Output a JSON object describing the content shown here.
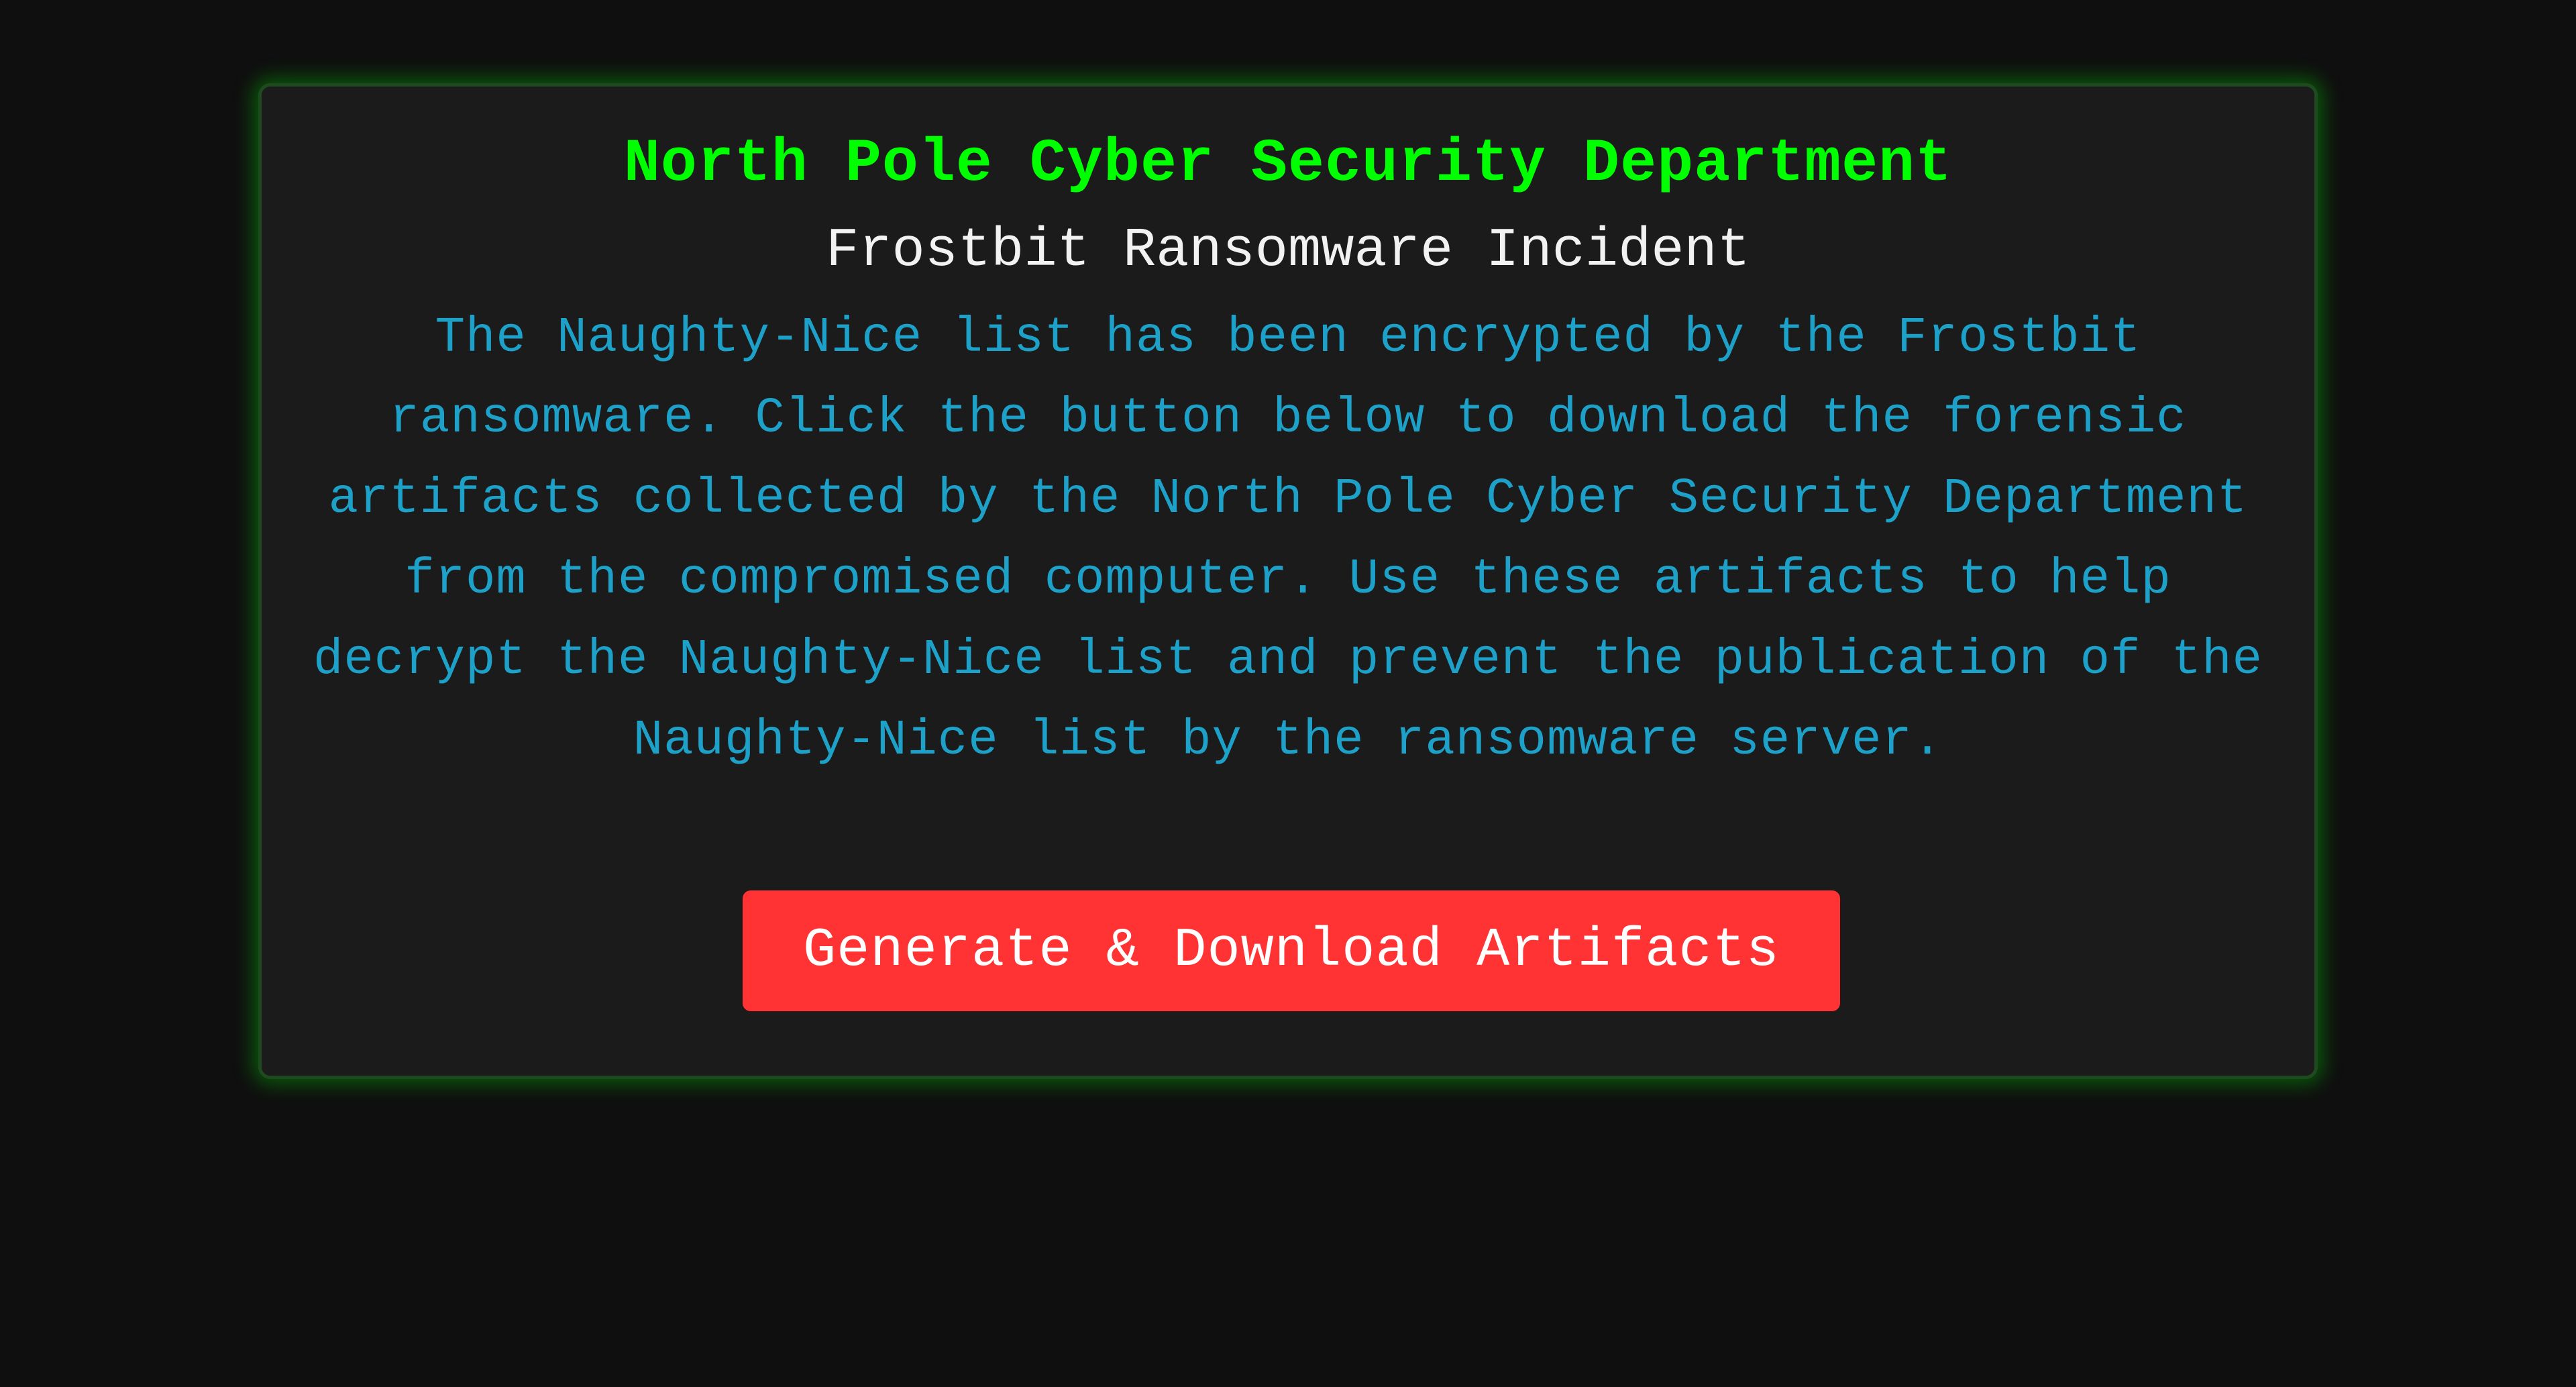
{
  "page": {
    "background_color": "#0f0f0f"
  },
  "card": {
    "title": "North Pole Cyber Security Department",
    "subtitle": "Frostbit Ransomware Incident",
    "description": "The Naughty-Nice list has been encrypted by the Frostbit ransomware. Click the button below to download the forensic artifacts collected by the North Pole Cyber Security Department from the compromised computer. Use these artifacts to help decrypt the Naughty-Nice list and prevent the publication of the Naughty-Nice list by the ransomware server.",
    "button_label": "Generate & Download Artifacts"
  },
  "colors": {
    "title": "#00ff00",
    "subtitle": "#f2f2f2",
    "description": "#1da1c8",
    "button_bg": "#ff3333",
    "button_text": "#ffffff",
    "card_bg": "#1b1b1b",
    "card_glow": "#00d200"
  }
}
